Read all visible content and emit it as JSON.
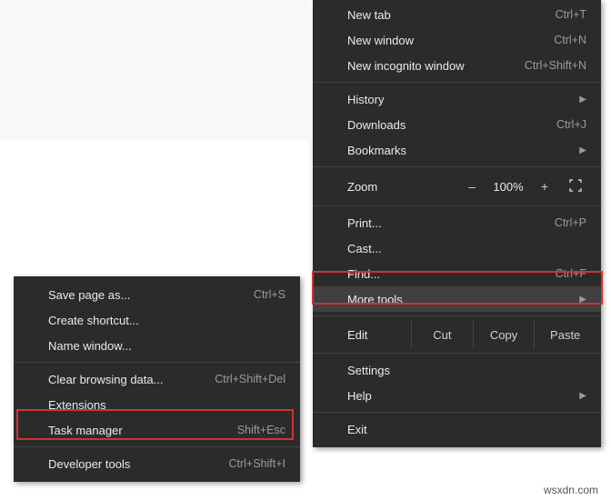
{
  "menu": {
    "new_tab": {
      "label": "New tab",
      "shortcut": "Ctrl+T"
    },
    "new_window": {
      "label": "New window",
      "shortcut": "Ctrl+N"
    },
    "incognito": {
      "label": "New incognito window",
      "shortcut": "Ctrl+Shift+N"
    },
    "history": {
      "label": "History"
    },
    "downloads": {
      "label": "Downloads",
      "shortcut": "Ctrl+J"
    },
    "bookmarks": {
      "label": "Bookmarks"
    },
    "zoom": {
      "label": "Zoom",
      "minus": "–",
      "value": "100%",
      "plus": "+"
    },
    "print": {
      "label": "Print...",
      "shortcut": "Ctrl+P"
    },
    "cast": {
      "label": "Cast..."
    },
    "find": {
      "label": "Find...",
      "shortcut": "Ctrl+F"
    },
    "more_tools": {
      "label": "More tools"
    },
    "edit": {
      "label": "Edit",
      "cut": "Cut",
      "copy": "Copy",
      "paste": "Paste"
    },
    "settings": {
      "label": "Settings"
    },
    "help": {
      "label": "Help"
    },
    "exit": {
      "label": "Exit"
    }
  },
  "submenu": {
    "save_page": {
      "label": "Save page as...",
      "shortcut": "Ctrl+S"
    },
    "create_shortcut": {
      "label": "Create shortcut..."
    },
    "name_window": {
      "label": "Name window..."
    },
    "clear_data": {
      "label": "Clear browsing data...",
      "shortcut": "Ctrl+Shift+Del"
    },
    "extensions": {
      "label": "Extensions"
    },
    "task_manager": {
      "label": "Task manager",
      "shortcut": "Shift+Esc"
    },
    "dev_tools": {
      "label": "Developer tools",
      "shortcut": "Ctrl+Shift+I"
    }
  },
  "watermark": "wsxdn.com"
}
